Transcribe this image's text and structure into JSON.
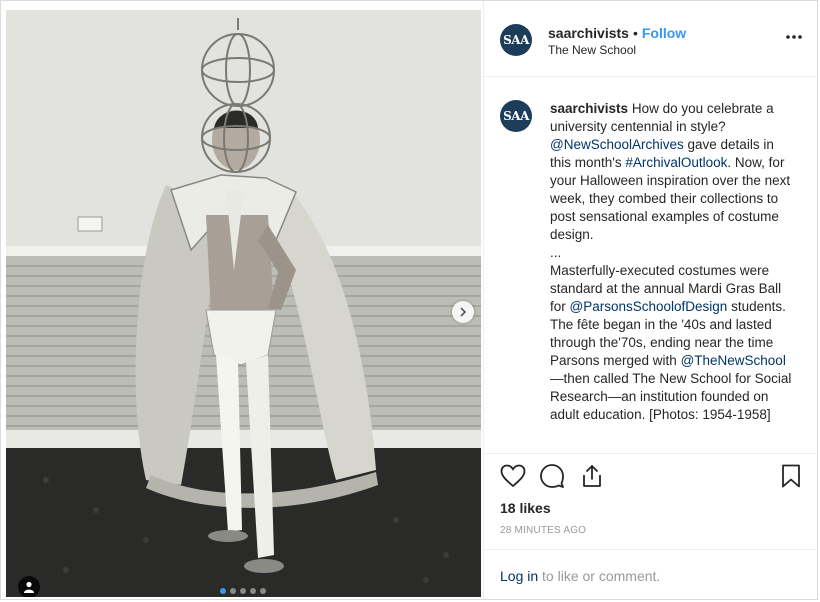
{
  "post": {
    "account": {
      "avatar_text": "SAA",
      "username": "saarchivists",
      "separator": "•",
      "follow_label": "Follow",
      "location": "The New School"
    },
    "caption": {
      "username": "saarchivists",
      "part1": " How do you celebrate a university centennial in style? ",
      "mention1": "@NewSchoolArchives",
      "part2": " gave details in this month's ",
      "hashtag1": "#ArchivalOutlook",
      "part3": ". Now, for your Halloween inspiration over the next week, they combed their collections to post sensational examples of costume design.",
      "ellipsis": "...",
      "part4": "Masterfully-executed costumes were standard at the annual Mardi Gras Ball for ",
      "mention2": "@ParsonsSchoolofDesign",
      "part5": " students. The fête began in the '40s and lasted through the'70s, ending near the time Parsons merged with ",
      "mention3": "@TheNewSchool",
      "part6": "—then called The New School for Social Research—an institution founded on adult education. [Photos: 1954-1958]"
    },
    "likes": "18 likes",
    "timestamp": "28 MINUTES AGO",
    "login": {
      "link_label": "Log in",
      "rest": " to like or comment."
    },
    "carousel": {
      "slide_count": 5,
      "active_slide": 1
    },
    "icons": {
      "more": "more-options-icon",
      "like": "heart-icon",
      "comment": "comment-icon",
      "share": "share-icon",
      "save": "bookmark-icon",
      "next": "chevron-right-icon",
      "tag": "user-tag-icon"
    },
    "colors": {
      "accent": "#3897f0",
      "link": "#003569",
      "avatar_bg": "#1c3d5a",
      "muted": "#999999"
    }
  }
}
